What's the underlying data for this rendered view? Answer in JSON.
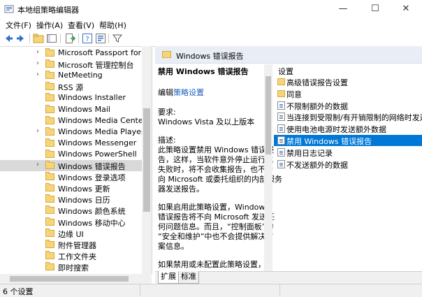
{
  "window": {
    "title": "本地组策略编辑器",
    "minimize": "—",
    "maximize": "☐",
    "close": "✕"
  },
  "menu": [
    "文件(F)",
    "操作(A)",
    "查看(V)",
    "帮助(H)"
  ],
  "tree": {
    "items": [
      {
        "label": "Microsoft Passport for Wo",
        "expandable": true
      },
      {
        "label": "Microsoft 管理控制台",
        "expandable": true
      },
      {
        "label": "NetMeeting",
        "expandable": true
      },
      {
        "label": "RSS 源",
        "expandable": false
      },
      {
        "label": "Windows Installer",
        "expandable": false
      },
      {
        "label": "Windows Mail",
        "expandable": false
      },
      {
        "label": "Windows Media Center",
        "expandable": false
      },
      {
        "label": "Windows Media Player",
        "expandable": true
      },
      {
        "label": "Windows Messenger",
        "expandable": false
      },
      {
        "label": "Windows PowerShell",
        "expandable": false
      },
      {
        "label": "Windows 错误报告",
        "expandable": true,
        "selected": true
      },
      {
        "label": "Windows 登录选项",
        "expandable": false
      },
      {
        "label": "Windows 更新",
        "expandable": false
      },
      {
        "label": "Windows 日历",
        "expandable": false
      },
      {
        "label": "Windows 颜色系统",
        "expandable": false
      },
      {
        "label": "Windows 移动中心",
        "expandable": false
      },
      {
        "label": "边缘 UI",
        "expandable": false
      },
      {
        "label": "附件管理器",
        "expandable": false
      },
      {
        "label": "工作文件夹",
        "expandable": false
      },
      {
        "label": "即时搜索",
        "expandable": false
      }
    ]
  },
  "right": {
    "header_title": "Windows 错误报告",
    "description": {
      "title": "禁用 Windows 错误报告",
      "edit_prefix": "编辑",
      "edit_link": "策略设置",
      "requirements_label": "要求:",
      "requirements_value": "Windows Vista 及以上版本",
      "desc_label": "描述:",
      "desc_lines": [
        "此策略设置禁用 Windows 错误报",
        "告，这样，当软件意外停止运行或",
        "失败时，将不会收集报告，也不会",
        "向 Microsoft 或委托组织的内部服务",
        "器发送报告。"
      ],
      "para2_lines": [
        "如果启用此策略设置，Windows",
        "错误报告将不向 Microsoft 发送任",
        "何问题信息。而且，“控制面板”的",
        "“安全和维护”中也不会提供解决方",
        "案信息。"
      ],
      "para3_lines": [
        "如果禁用或未配置此策略设置，则"
      ]
    },
    "settings_header": "设置",
    "settings": [
      {
        "label": "高级错误报告设置",
        "type": "folder"
      },
      {
        "label": "同意",
        "type": "folder"
      },
      {
        "label": "不限制额外的数据",
        "type": "policy"
      },
      {
        "label": "当连接到受限制/有开销限制的网络时发送数据",
        "type": "policy"
      },
      {
        "label": "使用电池电源时发送额外数据",
        "type": "policy"
      },
      {
        "label": "禁用 Windows 错误报告",
        "type": "policy",
        "selected": true
      },
      {
        "label": "禁用日志记录",
        "type": "policy"
      },
      {
        "label": "不发送额外的数据",
        "type": "policy"
      }
    ]
  },
  "tabs": [
    "扩展",
    "标准"
  ],
  "status": "6 个设置",
  "colors": {
    "selection": "#0078d7",
    "link": "#1f5fbf",
    "folder": "#f6d57a"
  }
}
